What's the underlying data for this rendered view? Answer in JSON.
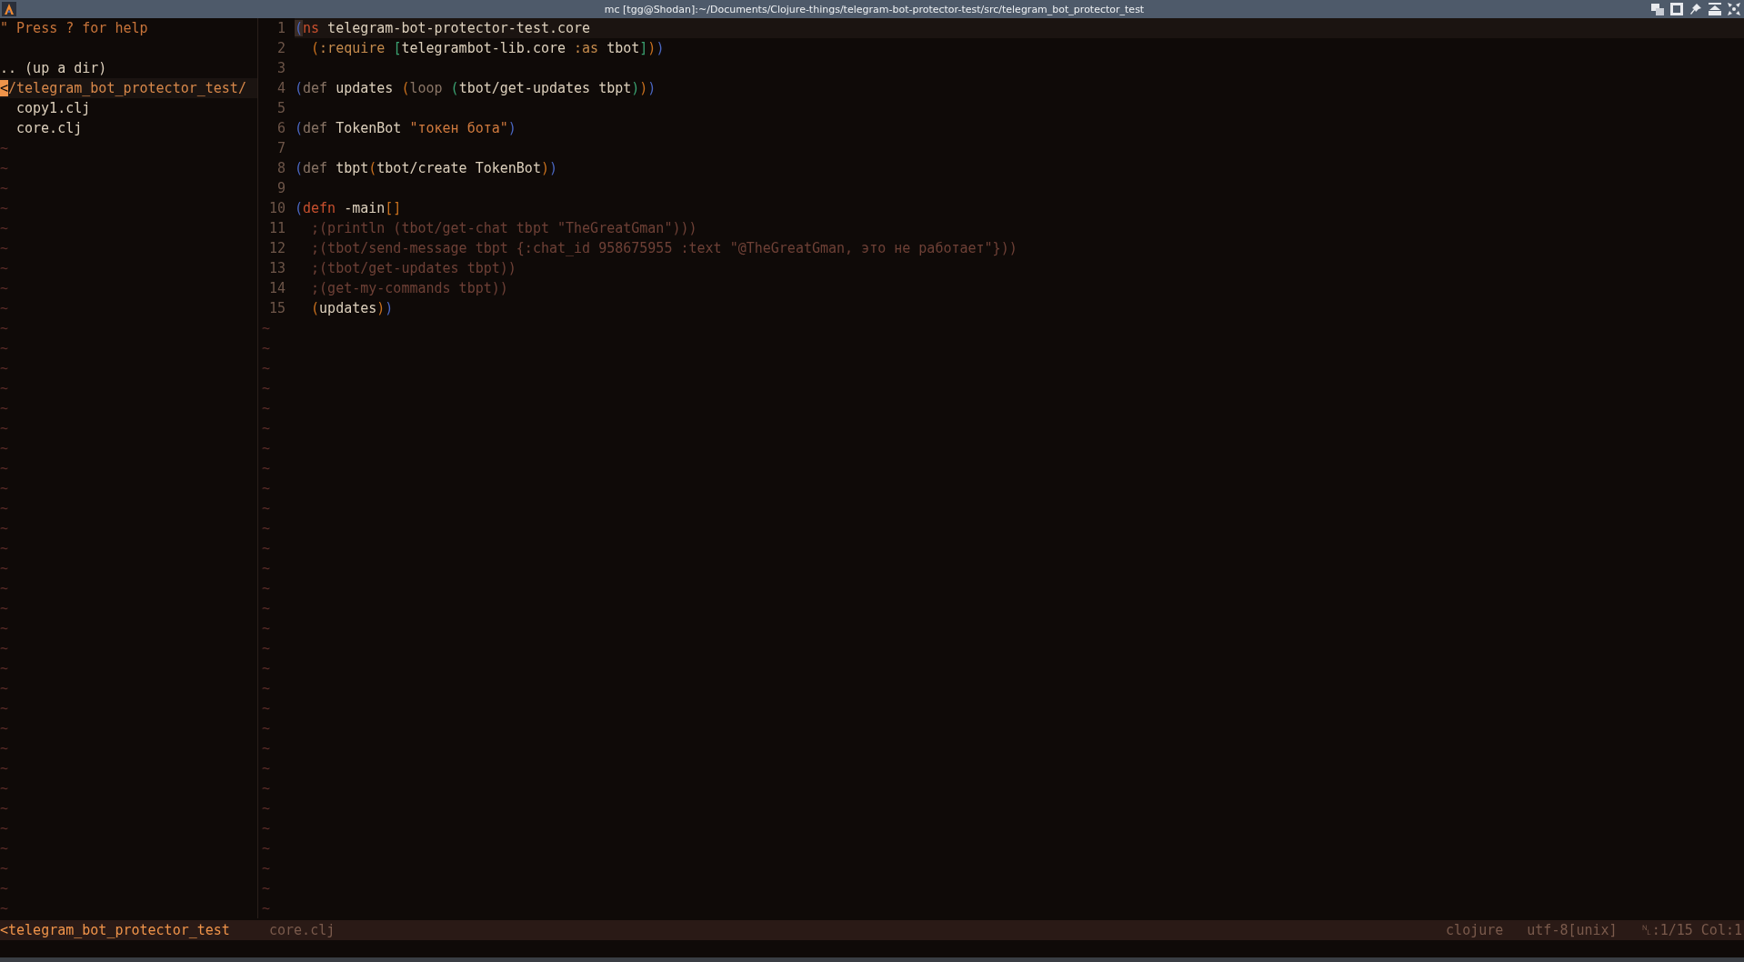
{
  "window": {
    "title": "mc [tgg@Shodan]:~/Documents/Clojure-things/telegram-bot-protector-test/src/telegram_bot_protector_test"
  },
  "file_tree": {
    "help": "\" Press ? for help",
    "items": [
      {
        "text": ".. (up a dir)",
        "kind": "parent",
        "selected": false
      },
      {
        "text": "</telegram_bot_protector_test/",
        "kind": "dir",
        "selected": true
      },
      {
        "text": "copy1.clj",
        "kind": "file",
        "selected": false
      },
      {
        "text": "core.clj",
        "kind": "file",
        "selected": false
      }
    ],
    "filler": [
      "~",
      "~",
      "~",
      "~",
      "~",
      "~",
      "~",
      "~",
      "~",
      "~",
      "~",
      "~",
      "~",
      "~",
      "~",
      "~",
      "~",
      "~",
      "~",
      "~",
      "~",
      "~",
      "~",
      "~",
      "~",
      "~",
      "~",
      "~",
      "~",
      "~",
      "~",
      "~",
      "~",
      "~",
      "~",
      "~",
      "~",
      "~",
      "~"
    ]
  },
  "editor": {
    "lines": [
      {
        "number": "1",
        "current": true,
        "tokens": [
          {
            "text": "(",
            "kind": "paren-1"
          },
          {
            "text": "ns",
            "kind": "special"
          },
          {
            "text": " telegram-bot-protector-test.core",
            "kind": "name"
          }
        ]
      },
      {
        "number": "2",
        "current": false,
        "tokens": [
          {
            "text": "  (",
            "kind": "paren-2"
          },
          {
            "text": ":require ",
            "kind": "keyword"
          },
          {
            "text": "[",
            "kind": "paren-3"
          },
          {
            "text": "telegrambot-lib.core ",
            "kind": "name"
          },
          {
            "text": ":as",
            "kind": "keyword"
          },
          {
            "text": " tbot",
            "kind": "name"
          },
          {
            "text": "]",
            "kind": "paren-3"
          },
          {
            "text": ")",
            "kind": "paren-2"
          },
          {
            "text": ")",
            "kind": "paren-1"
          }
        ]
      },
      {
        "number": "3",
        "current": false
      },
      {
        "number": "4",
        "current": false,
        "tokens": [
          {
            "text": "(",
            "kind": "paren-1"
          },
          {
            "text": "def",
            "kind": "def"
          },
          {
            "text": " updates ",
            "kind": "name"
          },
          {
            "text": "(",
            "kind": "paren-2"
          },
          {
            "text": "loop ",
            "kind": "def"
          },
          {
            "text": "(",
            "kind": "paren-3"
          },
          {
            "text": "tbot/get-updates tbpt",
            "kind": "name"
          },
          {
            "text": ")",
            "kind": "paren-3"
          },
          {
            "text": ")",
            "kind": "paren-2"
          },
          {
            "text": ")",
            "kind": "paren-1"
          }
        ]
      },
      {
        "number": "5",
        "current": false
      },
      {
        "number": "6",
        "current": false,
        "tokens": [
          {
            "text": "(",
            "kind": "paren-1"
          },
          {
            "text": "def",
            "kind": "def"
          },
          {
            "text": " TokenBot ",
            "kind": "name"
          },
          {
            "text": "\"токен бота\"",
            "kind": "string"
          },
          {
            "text": ")",
            "kind": "paren-1"
          }
        ]
      },
      {
        "number": "7",
        "current": false
      },
      {
        "number": "8",
        "current": false,
        "tokens": [
          {
            "text": "(",
            "kind": "paren-1"
          },
          {
            "text": "def",
            "kind": "def"
          },
          {
            "text": " tbpt",
            "kind": "name"
          },
          {
            "text": "(",
            "kind": "paren-2"
          },
          {
            "text": "tbot/create TokenBot",
            "kind": "name"
          },
          {
            "text": ")",
            "kind": "paren-2"
          },
          {
            "text": ")",
            "kind": "paren-1"
          }
        ]
      },
      {
        "number": "9",
        "current": false
      },
      {
        "number": "10",
        "current": false,
        "tokens": [
          {
            "text": "(",
            "kind": "paren-1"
          },
          {
            "text": "defn",
            "kind": "special"
          },
          {
            "text": " -main",
            "kind": "name"
          },
          {
            "text": "[]",
            "kind": "paren-2"
          }
        ]
      },
      {
        "number": "11",
        "current": false,
        "tokens": [
          {
            "text": "  ;(println (tbot/get-chat tbpt \"TheGreatGman\")))",
            "kind": "comment"
          }
        ]
      },
      {
        "number": "12",
        "current": false,
        "tokens": [
          {
            "text": "  ;(tbot/send-message tbpt {:chat_id 958675955 :text \"@TheGreatGman, это не работает\"}))",
            "kind": "comment"
          }
        ]
      },
      {
        "number": "13",
        "current": false,
        "tokens": [
          {
            "text": "  ;(tbot/get-updates tbpt))",
            "kind": "comment"
          }
        ]
      },
      {
        "number": "14",
        "current": false,
        "tokens": [
          {
            "text": "  ;(get-my-commands tbpt))",
            "kind": "comment"
          }
        ]
      },
      {
        "number": "15",
        "current": false,
        "tokens": [
          {
            "text": "  (",
            "kind": "paren-2"
          },
          {
            "text": "updates",
            "kind": "name"
          },
          {
            "text": ")",
            "kind": "paren-2"
          },
          {
            "text": ")",
            "kind": "paren-1"
          }
        ]
      }
    ],
    "filler": [
      "~",
      "~",
      "~",
      "~",
      "~",
      "~",
      "~",
      "~",
      "~",
      "~",
      "~",
      "~",
      "~",
      "~",
      "~",
      "~",
      "~",
      "~",
      "~",
      "~",
      "~",
      "~",
      "~",
      "~",
      "~",
      "~",
      "~",
      "~",
      "~",
      "~"
    ]
  },
  "status_bar": {
    "directory": "<telegram_bot_protector_test",
    "file": "core.clj",
    "filetype": "clojure",
    "encoding": "utf-8[unix]",
    "position": "␤:1/15 Col:1"
  }
}
